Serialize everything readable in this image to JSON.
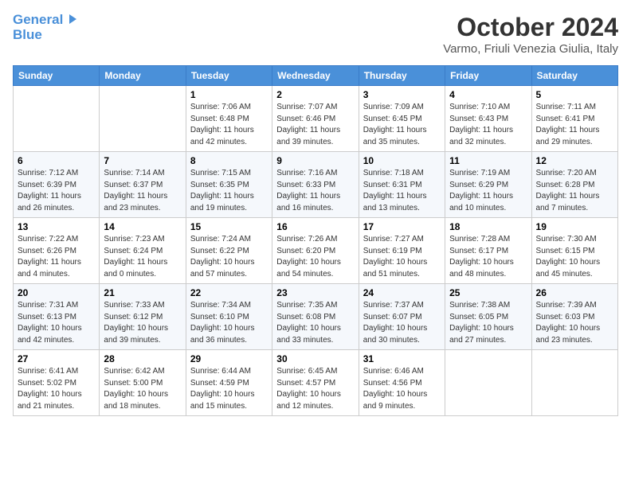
{
  "header": {
    "logo_line1_plain": "General",
    "logo_line1_colored": "",
    "logo_line2": "Blue",
    "month_title": "October 2024",
    "location": "Varmo, Friuli Venezia Giulia, Italy"
  },
  "columns": [
    "Sunday",
    "Monday",
    "Tuesday",
    "Wednesday",
    "Thursday",
    "Friday",
    "Saturday"
  ],
  "weeks": [
    [
      {
        "day": "",
        "info": ""
      },
      {
        "day": "",
        "info": ""
      },
      {
        "day": "1",
        "info": "Sunrise: 7:06 AM\nSunset: 6:48 PM\nDaylight: 11 hours and 42 minutes."
      },
      {
        "day": "2",
        "info": "Sunrise: 7:07 AM\nSunset: 6:46 PM\nDaylight: 11 hours and 39 minutes."
      },
      {
        "day": "3",
        "info": "Sunrise: 7:09 AM\nSunset: 6:45 PM\nDaylight: 11 hours and 35 minutes."
      },
      {
        "day": "4",
        "info": "Sunrise: 7:10 AM\nSunset: 6:43 PM\nDaylight: 11 hours and 32 minutes."
      },
      {
        "day": "5",
        "info": "Sunrise: 7:11 AM\nSunset: 6:41 PM\nDaylight: 11 hours and 29 minutes."
      }
    ],
    [
      {
        "day": "6",
        "info": "Sunrise: 7:12 AM\nSunset: 6:39 PM\nDaylight: 11 hours and 26 minutes."
      },
      {
        "day": "7",
        "info": "Sunrise: 7:14 AM\nSunset: 6:37 PM\nDaylight: 11 hours and 23 minutes."
      },
      {
        "day": "8",
        "info": "Sunrise: 7:15 AM\nSunset: 6:35 PM\nDaylight: 11 hours and 19 minutes."
      },
      {
        "day": "9",
        "info": "Sunrise: 7:16 AM\nSunset: 6:33 PM\nDaylight: 11 hours and 16 minutes."
      },
      {
        "day": "10",
        "info": "Sunrise: 7:18 AM\nSunset: 6:31 PM\nDaylight: 11 hours and 13 minutes."
      },
      {
        "day": "11",
        "info": "Sunrise: 7:19 AM\nSunset: 6:29 PM\nDaylight: 11 hours and 10 minutes."
      },
      {
        "day": "12",
        "info": "Sunrise: 7:20 AM\nSunset: 6:28 PM\nDaylight: 11 hours and 7 minutes."
      }
    ],
    [
      {
        "day": "13",
        "info": "Sunrise: 7:22 AM\nSunset: 6:26 PM\nDaylight: 11 hours and 4 minutes."
      },
      {
        "day": "14",
        "info": "Sunrise: 7:23 AM\nSunset: 6:24 PM\nDaylight: 11 hours and 0 minutes."
      },
      {
        "day": "15",
        "info": "Sunrise: 7:24 AM\nSunset: 6:22 PM\nDaylight: 10 hours and 57 minutes."
      },
      {
        "day": "16",
        "info": "Sunrise: 7:26 AM\nSunset: 6:20 PM\nDaylight: 10 hours and 54 minutes."
      },
      {
        "day": "17",
        "info": "Sunrise: 7:27 AM\nSunset: 6:19 PM\nDaylight: 10 hours and 51 minutes."
      },
      {
        "day": "18",
        "info": "Sunrise: 7:28 AM\nSunset: 6:17 PM\nDaylight: 10 hours and 48 minutes."
      },
      {
        "day": "19",
        "info": "Sunrise: 7:30 AM\nSunset: 6:15 PM\nDaylight: 10 hours and 45 minutes."
      }
    ],
    [
      {
        "day": "20",
        "info": "Sunrise: 7:31 AM\nSunset: 6:13 PM\nDaylight: 10 hours and 42 minutes."
      },
      {
        "day": "21",
        "info": "Sunrise: 7:33 AM\nSunset: 6:12 PM\nDaylight: 10 hours and 39 minutes."
      },
      {
        "day": "22",
        "info": "Sunrise: 7:34 AM\nSunset: 6:10 PM\nDaylight: 10 hours and 36 minutes."
      },
      {
        "day": "23",
        "info": "Sunrise: 7:35 AM\nSunset: 6:08 PM\nDaylight: 10 hours and 33 minutes."
      },
      {
        "day": "24",
        "info": "Sunrise: 7:37 AM\nSunset: 6:07 PM\nDaylight: 10 hours and 30 minutes."
      },
      {
        "day": "25",
        "info": "Sunrise: 7:38 AM\nSunset: 6:05 PM\nDaylight: 10 hours and 27 minutes."
      },
      {
        "day": "26",
        "info": "Sunrise: 7:39 AM\nSunset: 6:03 PM\nDaylight: 10 hours and 23 minutes."
      }
    ],
    [
      {
        "day": "27",
        "info": "Sunrise: 6:41 AM\nSunset: 5:02 PM\nDaylight: 10 hours and 21 minutes."
      },
      {
        "day": "28",
        "info": "Sunrise: 6:42 AM\nSunset: 5:00 PM\nDaylight: 10 hours and 18 minutes."
      },
      {
        "day": "29",
        "info": "Sunrise: 6:44 AM\nSunset: 4:59 PM\nDaylight: 10 hours and 15 minutes."
      },
      {
        "day": "30",
        "info": "Sunrise: 6:45 AM\nSunset: 4:57 PM\nDaylight: 10 hours and 12 minutes."
      },
      {
        "day": "31",
        "info": "Sunrise: 6:46 AM\nSunset: 4:56 PM\nDaylight: 10 hours and 9 minutes."
      },
      {
        "day": "",
        "info": ""
      },
      {
        "day": "",
        "info": ""
      }
    ]
  ]
}
